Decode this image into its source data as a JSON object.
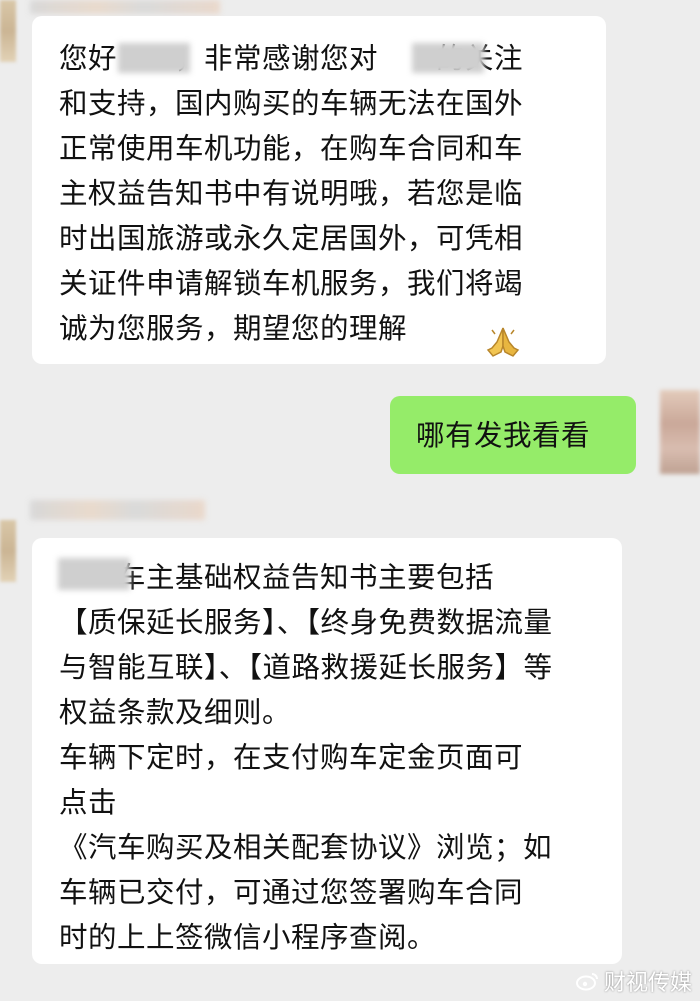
{
  "messages": [
    {
      "side": "left",
      "text": "您好　　，非常感谢您对　　的关注\n和支持，国内购买的车辆无法在国外\n正常使用车机功能，在购车合同和车\n主权益告知书中有说明哦，若您是临\n时出国旅游或永久定居国外，可凭相\n关证件申请解锁车机服务，我们将竭\n诚为您服务，期望您的理解",
      "trailing_icon": "folded-hands-icon"
    },
    {
      "side": "right",
      "text": "哪有发我看看"
    },
    {
      "side": "left",
      "text": "　　车主基础权益告知书主要包括\n【质保延长服务】、【终身免费数据流量\n与智能互联】、【道路救援延长服务】等\n权益条款及细则。\n车辆下定时，在支付购车定金页面可\n点击\n《汽车购买及相关配套协议》浏览；如\n车辆已交付，可通过您签署购车合同\n时的上上签微信小程序查阅。"
    }
  ],
  "watermark": {
    "text": "财视传媒",
    "icon": "weibo-icon"
  },
  "colors": {
    "background": "#ededed",
    "bubble_incoming": "#ffffff",
    "bubble_outgoing": "#95ec69"
  }
}
